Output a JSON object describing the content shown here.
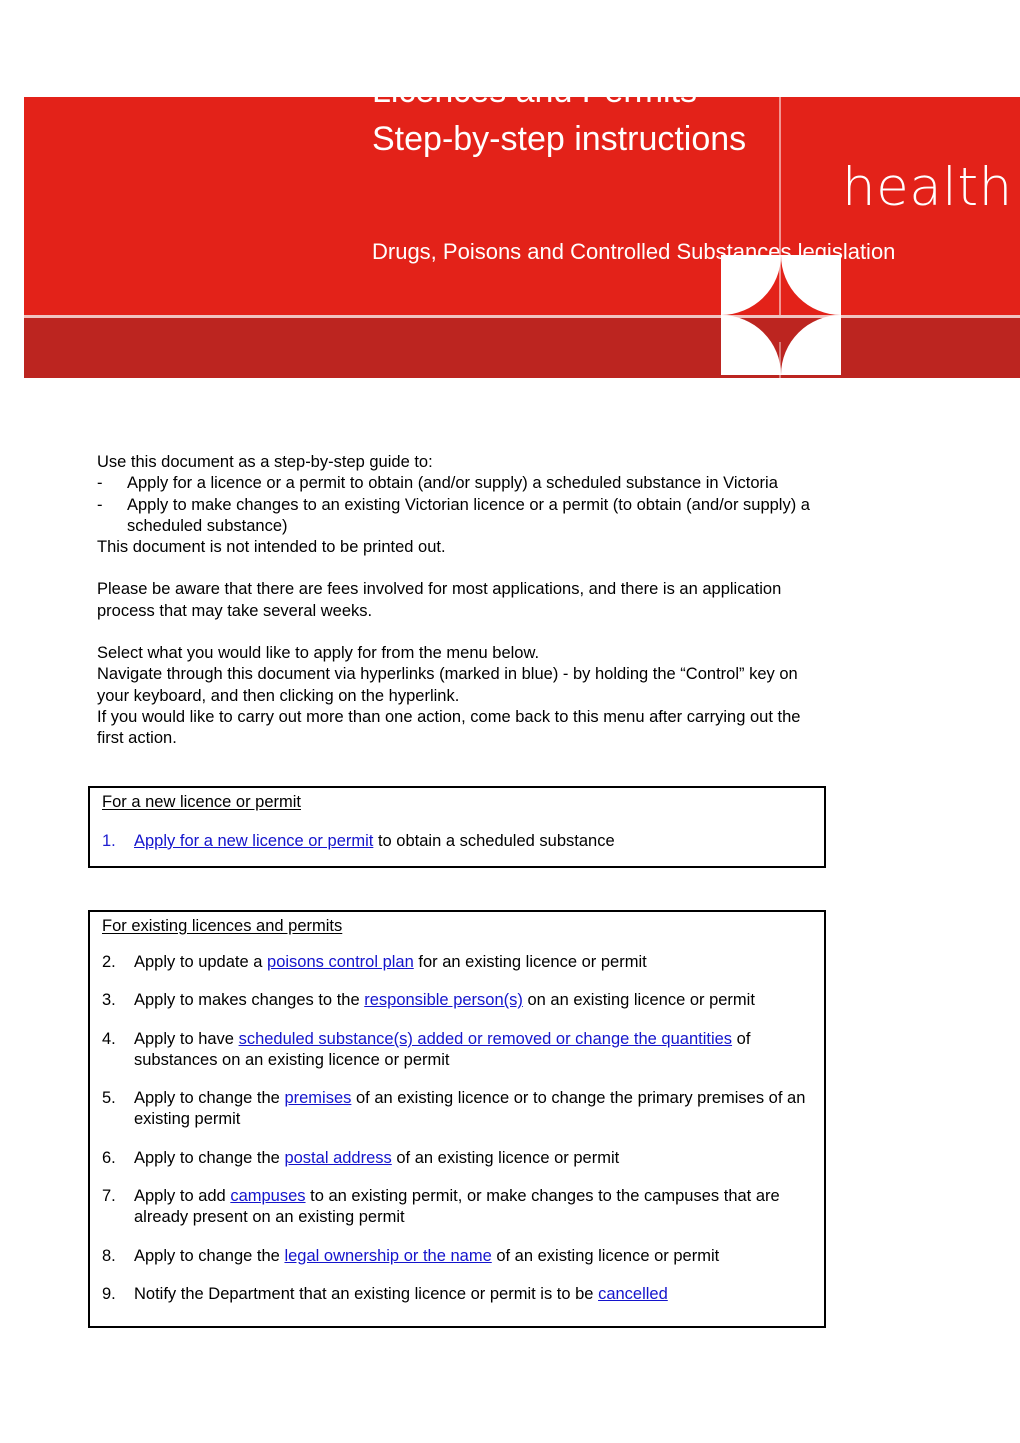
{
  "document": {
    "title_line1": "Licences and Permits",
    "title_line2": "Step-by-step instructions",
    "logo_text": "health",
    "subtitle": "Drugs, Poisons and Controlled Substances legislation",
    "colors": {
      "banner_red": "#e32219",
      "banner_dark_red": "#bc2520",
      "link_blue": "#1414cc",
      "text_black": "#000000"
    }
  },
  "intro": {
    "lead": "Use this document as a step-by-step guide to:",
    "bullet_marker": "-",
    "bullets": [
      "Apply for a licence or a permit to obtain (and/or supply) a scheduled substance in Victoria",
      "Apply to make changes to an existing Victorian licence or a permit (to obtain (and/or supply) a scheduled substance)"
    ],
    "not_printed": "This document is not intended to be printed out.",
    "fees_note": "Please be aware that there are fees involved for most applications, and there is an application process that may take several weeks.",
    "select_note": "Select what you would like to apply for from the menu below.",
    "navigate_note": "Navigate through this document via hyperlinks (marked in blue) - by holding the “Control” key on your keyboard, and then clicking on the hyperlink.",
    "return_note": "If you would like to carry out more than one action, come back to this menu after carrying out the first action."
  },
  "box_new": {
    "heading": "For a new licence or permit",
    "items": [
      {
        "number": "1.",
        "number_style": "link",
        "prefix": "",
        "link": "Apply for a new licence or permit",
        "suffix": " to obtain a scheduled substance"
      }
    ]
  },
  "box_existing": {
    "heading": "For existing licences and permits",
    "items": [
      {
        "number": "2.",
        "number_style": "plain",
        "prefix": "Apply to update a ",
        "link": "poisons control plan",
        "suffix": " for an existing licence or permit"
      },
      {
        "number": "3.",
        "number_style": "plain",
        "prefix": "Apply to makes changes to the ",
        "link": "responsible person(s)",
        "suffix": " on an existing licence or permit"
      },
      {
        "number": "4.",
        "number_style": "plain",
        "prefix": "Apply to have ",
        "link": "scheduled substance(s) added or removed or change the quantities",
        "suffix": " of substances on an existing licence or permit"
      },
      {
        "number": "5.",
        "number_style": "plain",
        "prefix": "Apply to change the ",
        "link": "premises",
        "suffix": " of an existing licence or to change the primary premises of an existing permit"
      },
      {
        "number": "6.",
        "number_style": "plain",
        "prefix": "Apply to change the ",
        "link": "postal address",
        "suffix": " of an existing licence or permit"
      },
      {
        "number": "7.",
        "number_style": "plain",
        "prefix": "Apply to add ",
        "link": "campuses",
        "suffix": " to an existing permit, or make changes to the campuses that are already present on an existing permit"
      },
      {
        "number": "8.",
        "number_style": "plain",
        "prefix": "Apply to change the ",
        "link": "legal ownership or the name",
        "suffix": " of an existing licence or permit"
      },
      {
        "number": "9.",
        "number_style": "plain",
        "prefix": "Notify the Department that an existing licence or permit is to be ",
        "link": "cancelled",
        "suffix": ""
      }
    ]
  }
}
